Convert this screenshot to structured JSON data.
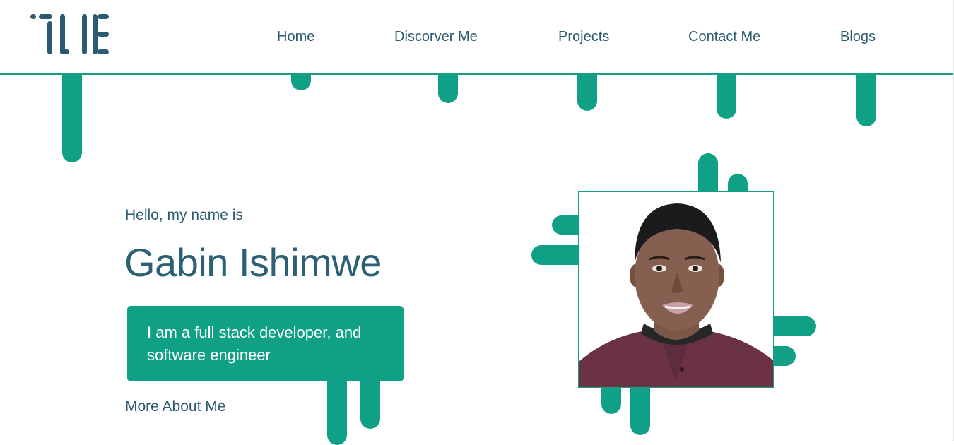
{
  "header": {
    "logo_text": "TLE",
    "nav": [
      {
        "label": "Home"
      },
      {
        "label": "Discorver Me"
      },
      {
        "label": "Projects"
      },
      {
        "label": "Contact Me"
      },
      {
        "label": "Blogs"
      }
    ]
  },
  "hero": {
    "greeting": "Hello, my name is",
    "name": "Gabin Ishimwe",
    "tagline": "I am a full stack developer, and software engineer",
    "more_link": "More About Me",
    "photo_alt": "Portrait of Gabin Ishimwe"
  },
  "colors": {
    "accent": "#10a085",
    "text": "#2b5b70",
    "background": "#ffffff"
  }
}
